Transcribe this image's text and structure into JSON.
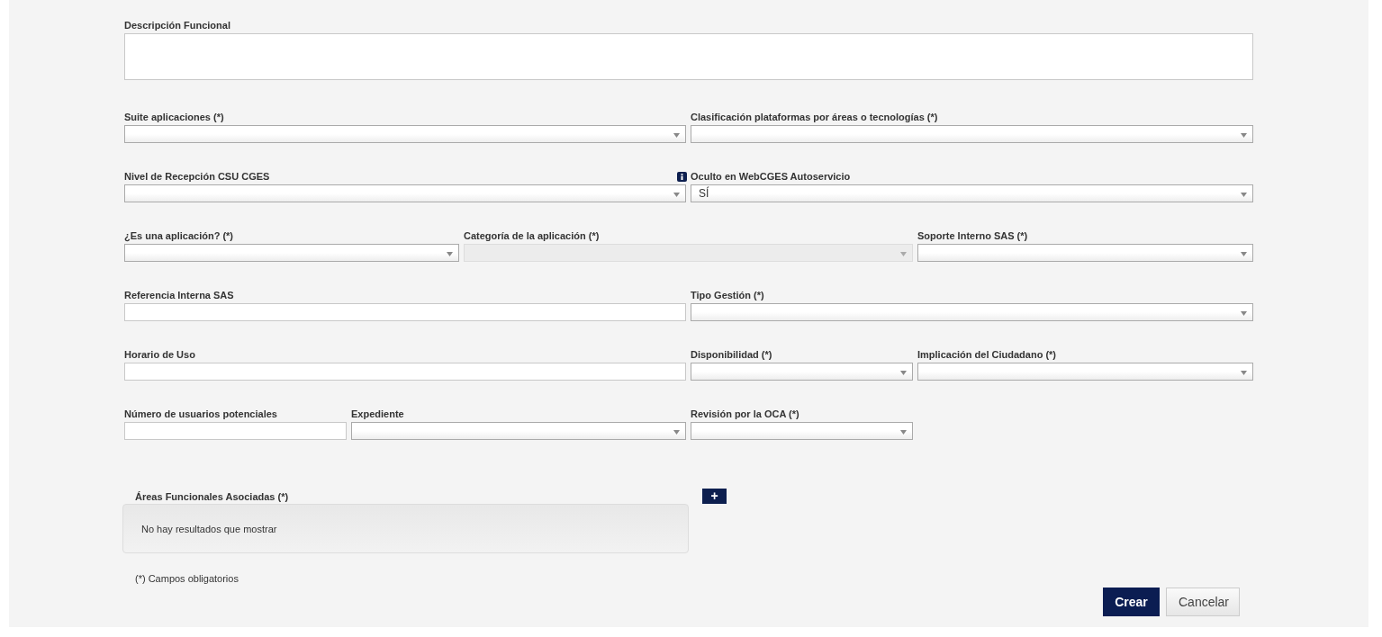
{
  "description": {
    "label": "Descripción Funcional"
  },
  "rows": [
    [
      {
        "label": "Suite aplicaciones (*)",
        "kind": "select",
        "disabled": false
      },
      {
        "label": "Clasificación plataformas por áreas o tecnologías (*)",
        "kind": "select",
        "disabled": false
      }
    ],
    [
      {
        "label": "Nivel de Recepción CSU CGES",
        "kind": "select",
        "disabled": false
      },
      {
        "label": "Oculto en WebCGES Autoservicio",
        "kind": "select",
        "disabled": false,
        "info": true,
        "value": "SÍ"
      }
    ],
    [
      {
        "label": "¿Es una aplicación? (*)",
        "kind": "select",
        "disabled": false
      },
      {
        "label": "Categoría de la aplicación (*)",
        "kind": "select",
        "disabled": true
      },
      {
        "label": "Soporte Interno SAS (*)",
        "kind": "select",
        "disabled": false
      }
    ],
    [
      {
        "label": "Referencia Interna SAS",
        "kind": "text"
      },
      {
        "label": "Tipo Gestión (*)",
        "kind": "select",
        "disabled": false
      }
    ],
    [
      {
        "label": "Horario de Uso",
        "kind": "text"
      },
      {
        "label": "Disponibilidad (*)",
        "kind": "select",
        "disabled": false
      },
      {
        "label": "Implicación del Ciudadano (*)",
        "kind": "select",
        "disabled": false
      }
    ],
    [
      {
        "label": "Número de usuarios potenciales",
        "kind": "text"
      },
      {
        "label": "Expediente",
        "kind": "select",
        "disabled": false
      },
      {
        "label": "Revisión por la OCA (*)",
        "kind": "select",
        "disabled": false
      }
    ]
  ],
  "areas": {
    "label": "Áreas Funcionales Asociadas (*)",
    "empty": "No hay resultados que mostrar",
    "add": "+"
  },
  "footnote": "(*) Campos obligatorios",
  "buttons": [
    {
      "label": "Crear",
      "kind": "primary"
    },
    {
      "label": "Cancelar",
      "kind": "secondary"
    }
  ]
}
